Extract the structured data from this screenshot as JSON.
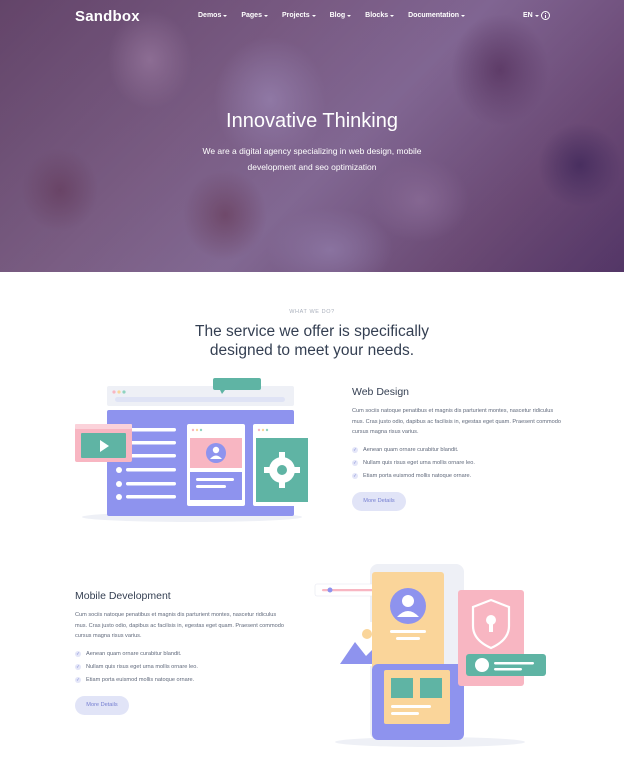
{
  "nav": {
    "logo": "Sandbox",
    "menu": [
      "Demos",
      "Pages",
      "Projects",
      "Blog",
      "Blocks",
      "Documentation"
    ],
    "lang": "EN"
  },
  "hero": {
    "title": "Innovative Thinking",
    "subtitle": "We are a digital agency specializing in web design, mobile development and seo optimization"
  },
  "section": {
    "eyebrow": "WHAT WE DO?",
    "title": "The service we offer is specifically designed to meet your needs."
  },
  "features": [
    {
      "title": "Web Design",
      "body": "Cum sociis natoque penatibus et magnis dis parturient montes, nascetur ridiculus mus. Cras justo odio, dapibus ac facilisis in, egestas eget quam. Praesent commodo cursus magna risus varius.",
      "items": [
        "Aenean quam ornare curabitur blandit.",
        "Nullam quis risus eget urna mollis ornare leo.",
        "Etiam porta euismod mollis natoque ornare."
      ],
      "button": "More Details"
    },
    {
      "title": "Mobile Development",
      "body": "Cum sociis natoque penatibus et magnis dis parturient montes, nascetur ridiculus mus. Cras justo odio, dapibus ac facilisis in, egestas eget quam. Praesent commodo cursus magna risus varius.",
      "items": [
        "Aenean quam ornare curabitur blandit.",
        "Nullam quis risus eget urna mollis ornare leo.",
        "Etiam porta euismod mollis natoque ornare."
      ],
      "button": "More Details"
    }
  ],
  "colors": {
    "accent": "#747ed1",
    "heading": "#343f52",
    "body": "#60697b",
    "overlay": "#5c3c8c"
  },
  "icons": {
    "check": "check-icon",
    "info": "info-icon",
    "caret": "chevron-down-icon"
  }
}
